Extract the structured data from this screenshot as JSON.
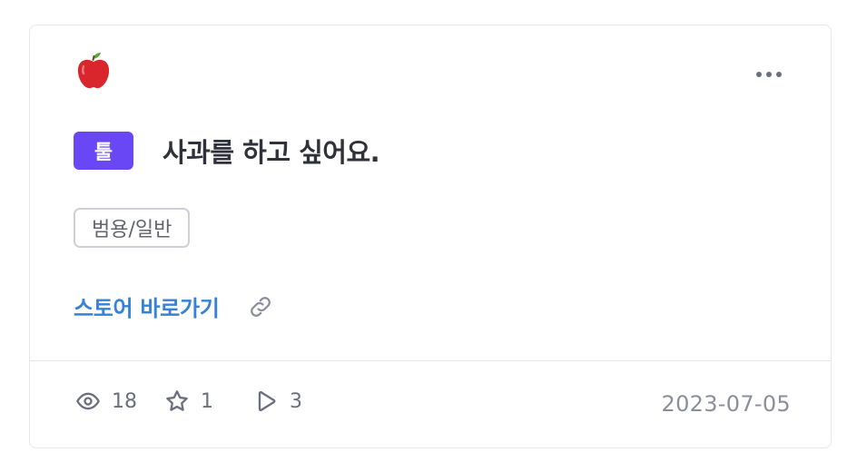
{
  "card": {
    "emoji": "apple-icon",
    "category_badge": "툴",
    "title": "사과를 하고 싶어요.",
    "tag": "범용/일반",
    "store_link": "스토어 바로가기",
    "stats": {
      "views": "18",
      "stars": "1",
      "plays": "3"
    },
    "date": "2023-07-05"
  },
  "colors": {
    "badge": "#6a47f5",
    "link": "#3682d8",
    "title": "#2f313b",
    "muted": "#6b6f7e",
    "border": "#e7e8ef"
  }
}
